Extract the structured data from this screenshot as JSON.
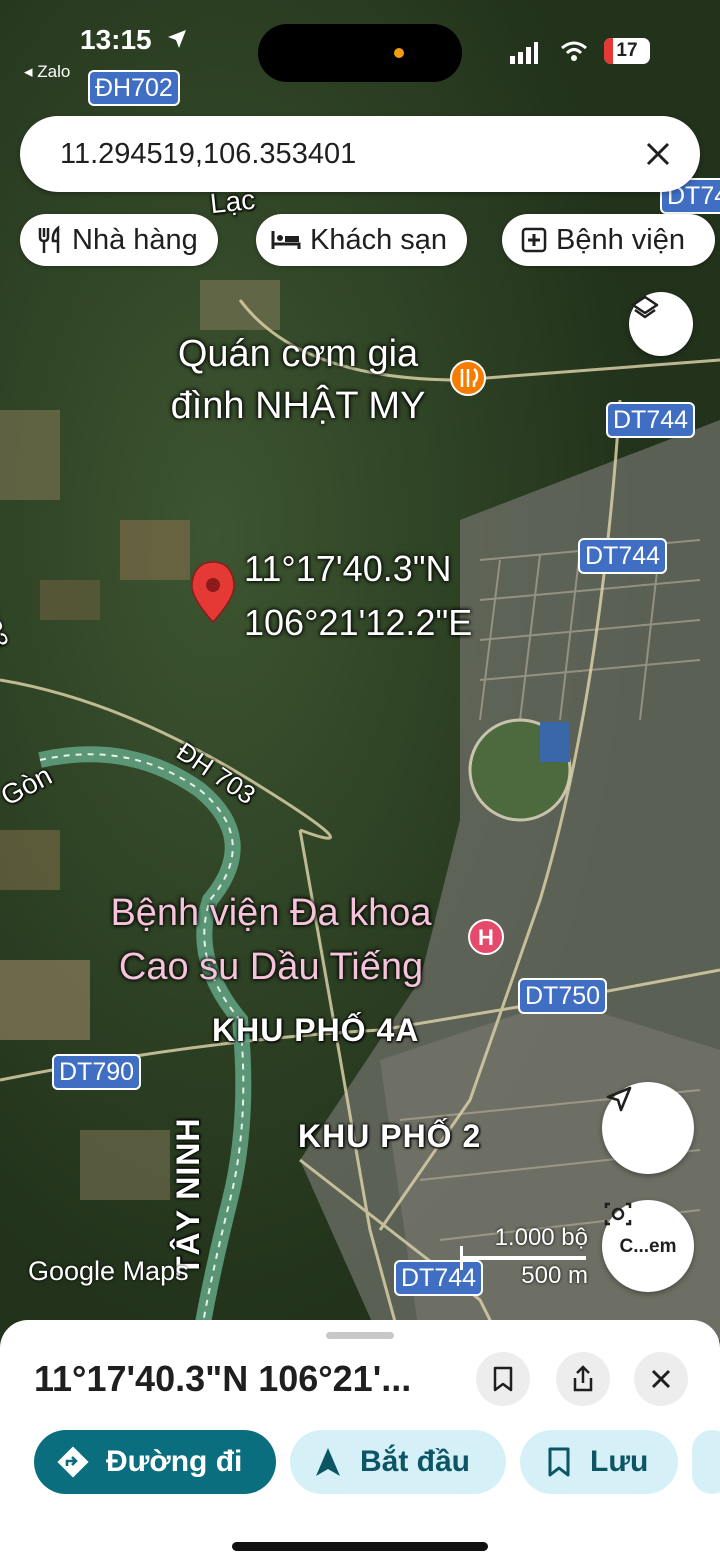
{
  "status_bar": {
    "time": "13:15",
    "back_app": "◂ Zalo",
    "battery": "17"
  },
  "search": {
    "value": "11.294519,106.353401"
  },
  "chips": [
    {
      "label": "Nhà hàng",
      "icon": "restaurant-icon"
    },
    {
      "label": "Khách sạn",
      "icon": "hotel-icon"
    },
    {
      "label": "Bệnh viện",
      "icon": "hospital-icon"
    }
  ],
  "map": {
    "route_shields": [
      "ĐH702",
      "DT74",
      "DT744",
      "DT744",
      "DT750",
      "DT790",
      "DT744"
    ],
    "road_labels": [
      "ĐH 703",
      "ĐH 703"
    ],
    "place_labels": {
      "top_partial": "Lạc",
      "river": "Gòn",
      "khu_pho_4a": "KHU PHỐ 4A",
      "khu_pho_2": "KHU PHỐ 2",
      "province": "TÂY NINH"
    },
    "poi_restaurant": {
      "line1": "Quán cơm gia",
      "line2": "đình NHẬT MY"
    },
    "poi_hospital": {
      "line1": "Bệnh viện Đa khoa",
      "line2": "Cao su Dầu Tiếng"
    },
    "pin_coords": {
      "lat": "11°17'40.3\"N",
      "lng": "106°21'12.2\"E"
    },
    "google_logo": "Google Maps",
    "scale": {
      "imperial": "1.000 bộ",
      "metric": "500 m"
    },
    "camera_button_label": "C...em"
  },
  "sheet": {
    "title": "11°17'40.3\"N 106°21'...",
    "actions": [
      {
        "label": "Đường đi",
        "icon": "directions-icon",
        "primary": true
      },
      {
        "label": "Bắt đầu",
        "icon": "navigation-arrow-icon",
        "primary": false
      },
      {
        "label": "Lưu",
        "icon": "bookmark-icon",
        "primary": false
      }
    ]
  },
  "colors": {
    "accent": "#0b6e7e",
    "chip_bg": "#d6f0f7",
    "shield": "#3f6ec2",
    "pin": "#e53935",
    "hospital_label": "#f5c3da"
  }
}
